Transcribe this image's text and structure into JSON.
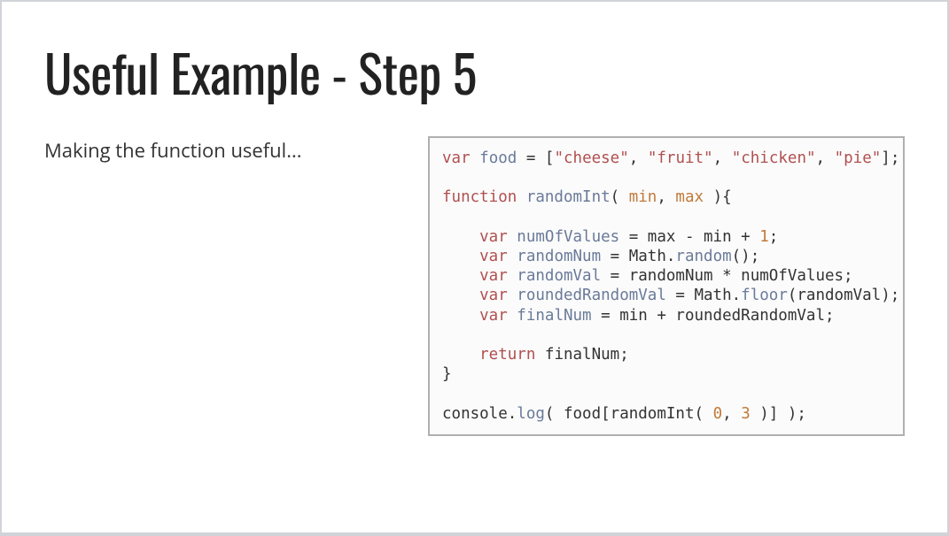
{
  "slide": {
    "title": "Useful Example - Step 5",
    "subtitle": "Making the function useful...",
    "code": {
      "lines": [
        [
          {
            "t": "var ",
            "c": "tok-kw"
          },
          {
            "t": "food",
            "c": "tok-var"
          },
          {
            "t": " = [",
            "c": "tok-plain"
          },
          {
            "t": "\"cheese\"",
            "c": "tok-str"
          },
          {
            "t": ", ",
            "c": "tok-plain"
          },
          {
            "t": "\"fruit\"",
            "c": "tok-str"
          },
          {
            "t": ", ",
            "c": "tok-plain"
          },
          {
            "t": "\"chicken\"",
            "c": "tok-str"
          },
          {
            "t": ", ",
            "c": "tok-plain"
          },
          {
            "t": "\"pie\"",
            "c": "tok-str"
          },
          {
            "t": "];",
            "c": "tok-plain"
          }
        ],
        [
          {
            "t": " ",
            "c": "tok-plain"
          }
        ],
        [
          {
            "t": "function ",
            "c": "tok-kw"
          },
          {
            "t": "randomInt",
            "c": "tok-fn"
          },
          {
            "t": "( ",
            "c": "tok-plain"
          },
          {
            "t": "min",
            "c": "tok-param"
          },
          {
            "t": ", ",
            "c": "tok-plain"
          },
          {
            "t": "max",
            "c": "tok-param"
          },
          {
            "t": " ){",
            "c": "tok-plain"
          }
        ],
        [
          {
            "t": " ",
            "c": "tok-plain"
          }
        ],
        [
          {
            "t": "    var ",
            "c": "tok-kw"
          },
          {
            "t": "numOfValues",
            "c": "tok-var"
          },
          {
            "t": " = max - min + ",
            "c": "tok-plain"
          },
          {
            "t": "1",
            "c": "tok-num"
          },
          {
            "t": ";",
            "c": "tok-plain"
          }
        ],
        [
          {
            "t": "    var ",
            "c": "tok-kw"
          },
          {
            "t": "randomNum",
            "c": "tok-var"
          },
          {
            "t": " = Math.",
            "c": "tok-plain"
          },
          {
            "t": "random",
            "c": "tok-method"
          },
          {
            "t": "();",
            "c": "tok-plain"
          }
        ],
        [
          {
            "t": "    var ",
            "c": "tok-kw"
          },
          {
            "t": "randomVal",
            "c": "tok-var"
          },
          {
            "t": " = randomNum * numOfValues;",
            "c": "tok-plain"
          }
        ],
        [
          {
            "t": "    var ",
            "c": "tok-kw"
          },
          {
            "t": "roundedRandomVal",
            "c": "tok-var"
          },
          {
            "t": " = Math.",
            "c": "tok-plain"
          },
          {
            "t": "floor",
            "c": "tok-method"
          },
          {
            "t": "(randomVal);",
            "c": "tok-plain"
          }
        ],
        [
          {
            "t": "    var ",
            "c": "tok-kw"
          },
          {
            "t": "finalNum",
            "c": "tok-var"
          },
          {
            "t": " = min + roundedRandomVal;",
            "c": "tok-plain"
          }
        ],
        [
          {
            "t": " ",
            "c": "tok-plain"
          }
        ],
        [
          {
            "t": "    return ",
            "c": "tok-kw"
          },
          {
            "t": "finalNum;",
            "c": "tok-plain"
          }
        ],
        [
          {
            "t": "}",
            "c": "tok-plain"
          }
        ],
        [
          {
            "t": " ",
            "c": "tok-plain"
          }
        ],
        [
          {
            "t": "console.",
            "c": "tok-plain"
          },
          {
            "t": "log",
            "c": "tok-method"
          },
          {
            "t": "( food[randomInt( ",
            "c": "tok-plain"
          },
          {
            "t": "0",
            "c": "tok-num"
          },
          {
            "t": ", ",
            "c": "tok-plain"
          },
          {
            "t": "3",
            "c": "tok-num"
          },
          {
            "t": " )] );",
            "c": "tok-plain"
          }
        ]
      ]
    }
  }
}
